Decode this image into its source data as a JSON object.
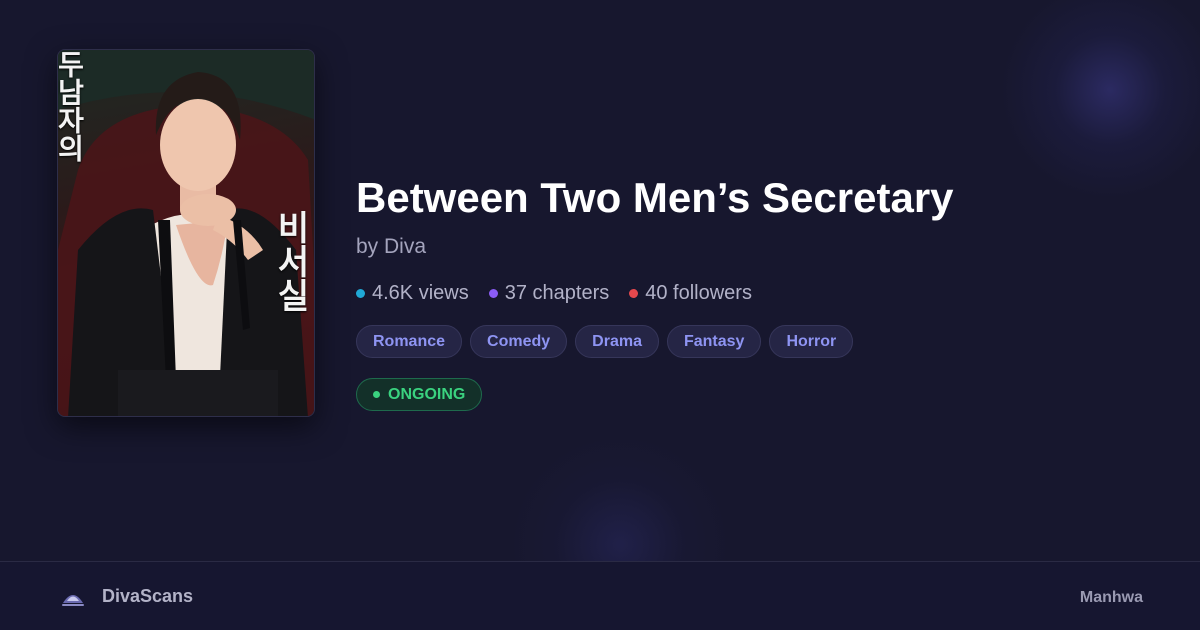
{
  "series": {
    "title": "Between Two Men’s Secretary",
    "author": "by Diva",
    "cover_text_left": "두남자의",
    "cover_text_right": "비서실"
  },
  "stats": [
    {
      "label": "4.6K views",
      "color": "#20a9d6"
    },
    {
      "label": "37 chapters",
      "color": "#8b5cf6"
    },
    {
      "label": "40 followers",
      "color": "#e5484d"
    }
  ],
  "tags": [
    "Romance",
    "Comedy",
    "Drama",
    "Fantasy",
    "Horror"
  ],
  "status": "ONGOING",
  "footer": {
    "brand": "DivaScans",
    "type": "Manhwa"
  }
}
